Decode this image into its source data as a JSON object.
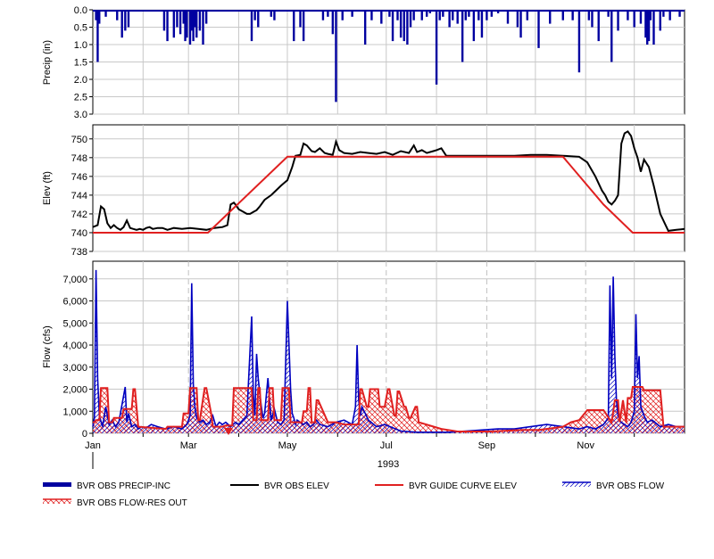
{
  "chart_data": [
    {
      "panel": "precip",
      "type": "bar",
      "ylabel": "Precip (in)",
      "ylim": [
        0,
        3.0
      ],
      "y_inverted": true,
      "yticks": [
        "0.0",
        "0.5",
        "1.0",
        "1.5",
        "2.0",
        "2.5",
        "3.0"
      ],
      "grid": true,
      "series": [
        {
          "name": "BVR OBS PRECIP-INC",
          "color": "#0000a0",
          "x": [
            2,
            3,
            4,
            8,
            15,
            18,
            20,
            22,
            44,
            46,
            50,
            52,
            54,
            56,
            57,
            58,
            60,
            61,
            62,
            63,
            64,
            66,
            68,
            70,
            98,
            100,
            102,
            110,
            112,
            124,
            128,
            130,
            142,
            145,
            148,
            150,
            154,
            160,
            168,
            172,
            178,
            183,
            185,
            188,
            190,
            192,
            194,
            196,
            198,
            203,
            206,
            208,
            212,
            214,
            216,
            220,
            222,
            225,
            228,
            230,
            232,
            235,
            238,
            240,
            243,
            246,
            250,
            256,
            262,
            264,
            268,
            275,
            282,
            290,
            296,
            300,
            306,
            308,
            312,
            318,
            320,
            324,
            330,
            334,
            338,
            341,
            342,
            343,
            344,
            346,
            350,
            352,
            356,
            362
          ],
          "y": [
            0.3,
            1.5,
            0.4,
            0.2,
            0.3,
            0.8,
            0.6,
            0.5,
            0.6,
            0.9,
            0.8,
            0.5,
            0.7,
            0.4,
            0.9,
            0.8,
            1.0,
            0.6,
            0.9,
            0.5,
            0.8,
            0.6,
            1.0,
            0.4,
            0.9,
            0.3,
            0.5,
            0.2,
            0.3,
            0.9,
            0.5,
            0.9,
            0.3,
            0.2,
            0.7,
            2.65,
            0.3,
            0.2,
            1.0,
            0.3,
            0.4,
            0.2,
            0.9,
            0.3,
            0.8,
            0.9,
            1.0,
            0.5,
            0.3,
            0.3,
            0.2,
            0.1,
            2.15,
            0.3,
            0.2,
            0.5,
            0.3,
            0.4,
            1.5,
            0.3,
            0.2,
            0.9,
            0.3,
            0.8,
            0.3,
            0.2,
            0.1,
            0.4,
            0.5,
            0.8,
            0.3,
            1.1,
            0.4,
            0.3,
            0.3,
            1.8,
            0.3,
            0.5,
            0.9,
            0.2,
            1.5,
            0.6,
            0.3,
            0.5,
            0.4,
            0.8,
            1.0,
            0.9,
            0.3,
            1.0,
            0.6,
            0.2,
            0.3,
            0.2
          ]
        }
      ]
    },
    {
      "panel": "elevation",
      "type": "line",
      "ylabel": "Elev (ft)",
      "ylim": [
        738,
        751.5
      ],
      "yticks": [
        "738",
        "740",
        "742",
        "744",
        "746",
        "748",
        "750"
      ],
      "grid": true,
      "series": [
        {
          "name": "BVR OBS ELEV",
          "color": "#000000",
          "x": [
            0,
            3,
            5,
            7,
            9,
            11,
            13,
            15,
            17,
            19,
            21,
            23,
            25,
            27,
            29,
            31,
            33,
            35,
            37,
            40,
            43,
            46,
            50,
            55,
            60,
            65,
            70,
            75,
            80,
            83,
            85,
            87,
            88,
            90,
            93,
            95,
            97,
            99,
            101,
            103,
            106,
            110,
            113,
            116,
            118,
            120,
            123,
            125,
            128,
            130,
            132,
            135,
            137,
            140,
            143,
            145,
            148,
            150,
            152,
            155,
            160,
            165,
            170,
            175,
            180,
            185,
            190,
            195,
            198,
            200,
            203,
            206,
            210,
            212,
            215,
            218,
            222,
            226,
            230,
            240,
            250,
            260,
            270,
            280,
            290,
            300,
            305,
            310,
            314,
            316,
            318,
            320,
            322,
            324,
            326,
            328,
            330,
            332,
            334,
            336,
            338,
            340,
            343,
            346,
            350,
            355,
            360,
            365
          ],
          "y": [
            740.6,
            740.8,
            742.8,
            742.5,
            741.0,
            740.5,
            740.8,
            740.5,
            740.3,
            740.6,
            741.3,
            740.5,
            740.4,
            740.3,
            740.4,
            740.3,
            740.5,
            740.6,
            740.4,
            740.5,
            740.5,
            740.3,
            740.5,
            740.4,
            740.5,
            740.4,
            740.3,
            740.5,
            740.6,
            740.8,
            743.0,
            743.2,
            743.0,
            742.5,
            742.2,
            742.0,
            742.0,
            742.2,
            742.4,
            742.8,
            743.5,
            744.0,
            744.5,
            745.0,
            745.3,
            745.6,
            747.0,
            748.2,
            748.3,
            749.5,
            749.3,
            748.7,
            748.6,
            749.0,
            748.5,
            748.4,
            748.3,
            749.7,
            748.8,
            748.5,
            748.4,
            748.6,
            748.5,
            748.4,
            748.6,
            748.3,
            748.7,
            748.5,
            749.3,
            748.6,
            748.8,
            748.5,
            748.7,
            748.8,
            749.0,
            748.2,
            748.2,
            748.2,
            748.2,
            748.2,
            748.2,
            748.2,
            748.3,
            748.3,
            748.2,
            748.1,
            747.5,
            746.0,
            744.5,
            744.0,
            743.3,
            743.0,
            743.4,
            744.0,
            749.5,
            750.6,
            750.8,
            750.3,
            749.0,
            748.0,
            746.5,
            747.8,
            747.0,
            745.0,
            742.0,
            740.2,
            740.3,
            740.4
          ]
        },
        {
          "name": "BVR GUIDE CURVE ELEV",
          "color": "#e02020",
          "x": [
            0,
            71,
            120,
            290,
            315,
            333,
            365
          ],
          "y": [
            740,
            740,
            748.1,
            748.1,
            743,
            740,
            740
          ]
        }
      ]
    },
    {
      "panel": "flow",
      "type": "area",
      "ylabel": "Flow (cfs)",
      "ylim": [
        0,
        7800
      ],
      "yticks": [
        "0",
        "1,000",
        "2,000",
        "3,000",
        "4,000",
        "5,000",
        "6,000",
        "7,000"
      ],
      "x_categories": [
        "Jan",
        "Mar",
        "May",
        "Jul",
        "Sep",
        "Nov"
      ],
      "x_category_days": [
        0,
        59,
        120,
        181,
        243,
        304
      ],
      "year_label": "1993",
      "grid": true,
      "series": [
        {
          "name": "BVR OBS FLOW",
          "color": "#0000c0",
          "x": [
            0,
            1,
            2,
            3,
            4,
            6,
            8,
            10,
            12,
            14,
            16,
            18,
            20,
            21,
            22,
            24,
            26,
            28,
            30,
            32,
            34,
            36,
            40,
            45,
            50,
            55,
            58,
            60,
            61,
            62,
            63,
            64,
            66,
            68,
            70,
            72,
            74,
            76,
            78,
            80,
            82,
            85,
            88,
            90,
            95,
            98,
            99,
            100,
            101,
            102,
            103,
            104,
            105,
            106,
            108,
            110,
            112,
            114,
            116,
            118,
            120,
            122,
            123,
            124,
            125,
            126,
            128,
            130,
            132,
            134,
            136,
            138,
            140,
            145,
            150,
            155,
            160,
            162,
            163,
            164,
            165,
            166,
            168,
            170,
            175,
            180,
            190,
            200,
            210,
            220,
            230,
            240,
            250,
            260,
            270,
            280,
            290,
            300,
            305,
            310,
            315,
            318,
            319,
            320,
            321,
            322,
            323,
            324,
            325,
            326,
            328,
            330,
            332,
            334,
            335,
            336,
            337,
            338,
            340,
            342,
            345,
            350,
            355,
            360,
            365
          ],
          "y": [
            300,
            700,
            7400,
            2500,
            800,
            300,
            1200,
            400,
            600,
            300,
            500,
            1300,
            2100,
            500,
            900,
            300,
            400,
            200,
            300,
            250,
            300,
            400,
            300,
            200,
            300,
            200,
            400,
            800,
            6800,
            2200,
            1200,
            700,
            500,
            600,
            400,
            500,
            800,
            300,
            500,
            400,
            500,
            300,
            500,
            400,
            800,
            5300,
            1800,
            800,
            3600,
            2500,
            1800,
            1200,
            700,
            900,
            2500,
            600,
            1100,
            500,
            400,
            600,
            6000,
            2000,
            900,
            700,
            400,
            600,
            500,
            400,
            500,
            300,
            400,
            600,
            400,
            300,
            500,
            600,
            400,
            1200,
            4000,
            1500,
            800,
            1200,
            900,
            600,
            300,
            400,
            100,
            50,
            50,
            50,
            100,
            150,
            200,
            200,
            300,
            400,
            300,
            200,
            300,
            200,
            400,
            700,
            6700,
            2500,
            7100,
            3500,
            1500,
            800,
            600,
            500,
            400,
            300,
            500,
            1000,
            5400,
            2500,
            3500,
            1200,
            800,
            500,
            600,
            300,
            400,
            300,
            300
          ]
        },
        {
          "name": "BVR OBS FLOW-RES OUT",
          "color": "#e02020",
          "x": [
            0,
            1,
            2,
            4,
            5,
            9,
            10,
            12,
            13,
            18,
            19,
            24,
            25,
            26,
            28,
            45,
            46,
            55,
            56,
            59,
            60,
            64,
            65,
            66,
            69,
            70,
            73,
            74,
            80,
            82,
            86,
            87,
            98,
            99,
            101,
            102,
            103,
            104,
            108,
            109,
            111,
            112,
            116,
            117,
            121,
            122,
            129,
            130,
            132,
            133,
            134,
            135,
            137,
            138,
            139,
            145,
            150,
            155,
            160,
            164,
            165,
            166,
            169,
            170,
            171,
            176,
            177,
            180,
            182,
            183,
            186,
            187,
            188,
            189,
            192,
            193,
            195,
            196,
            199,
            200,
            201,
            215,
            225,
            235,
            245,
            265,
            275,
            280,
            290,
            295,
            300,
            305,
            310,
            315,
            320,
            322,
            324,
            325,
            327,
            329,
            330,
            332,
            333,
            339,
            340,
            350,
            352,
            360,
            365
          ],
          "y": [
            500,
            500,
            600,
            600,
            2050,
            2050,
            500,
            500,
            700,
            700,
            1100,
            1100,
            2000,
            2000,
            300,
            200,
            300,
            300,
            900,
            900,
            2050,
            2050,
            600,
            600,
            2050,
            2050,
            900,
            300,
            300,
            350,
            350,
            2050,
            2050,
            600,
            600,
            2050,
            2050,
            600,
            600,
            2050,
            2050,
            600,
            600,
            2050,
            2050,
            500,
            500,
            1000,
            1000,
            2050,
            2050,
            500,
            500,
            1500,
            1500,
            500,
            500,
            400,
            400,
            400,
            2000,
            2000,
            1200,
            1200,
            2000,
            2000,
            1200,
            1200,
            2000,
            2000,
            800,
            800,
            1900,
            1900,
            1200,
            1200,
            700,
            700,
            1200,
            1200,
            500,
            200,
            80,
            80,
            80,
            150,
            150,
            200,
            300,
            500,
            600,
            1050,
            1050,
            1050,
            500,
            1500,
            1500,
            500,
            1500,
            500,
            1600,
            1600,
            2100,
            2100,
            1950,
            1950,
            300,
            300,
            300
          ]
        }
      ]
    }
  ],
  "legend": [
    {
      "label": "BVR OBS PRECIP-INC",
      "style": "thick-line",
      "color": "#0000a0"
    },
    {
      "label": "BVR OBS ELEV",
      "style": "line",
      "color": "#000000"
    },
    {
      "label": "BVR GUIDE CURVE ELEV",
      "style": "line",
      "color": "#e02020"
    },
    {
      "label": "BVR OBS FLOW",
      "style": "hatch-blue",
      "color": "#0000c0"
    },
    {
      "label": "BVR OBS FLOW-RES OUT",
      "style": "hatch-red",
      "color": "#e02020"
    }
  ]
}
